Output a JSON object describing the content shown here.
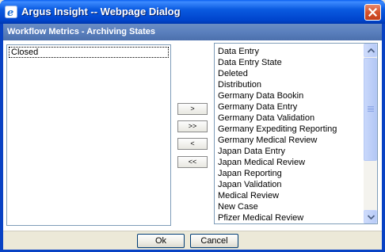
{
  "window": {
    "title": "Argus Insight -- Webpage Dialog",
    "icon": "ie-icon",
    "close_icon": "close-icon"
  },
  "header": {
    "title": "Workflow Metrics - Archiving States"
  },
  "left_list": {
    "items": [
      "Closed"
    ]
  },
  "move_buttons": {
    "add": ">",
    "add_all": ">>",
    "remove": "<",
    "remove_all": "<<"
  },
  "right_list": {
    "items": [
      "Data Entry",
      "Data Entry State",
      "Deleted",
      "Distribution",
      "Germany Data Bookin",
      "Germany Data Entry",
      "Germany Data Validation",
      "Germany Expediting Reporting",
      "Germany Medical Review",
      "Japan Data Entry",
      "Japan Medical Review",
      "Japan Reporting",
      "Japan Validation",
      "Medical Review",
      "New Case",
      "Pfizer Medical Review"
    ]
  },
  "footer": {
    "ok_label": "Ok",
    "cancel_label": "Cancel"
  },
  "colors": {
    "titlebar": "#0a5ae0",
    "header_bar": "#5a7fbd",
    "close_button": "#d5532d",
    "dialog_bg": "#ece9d8"
  }
}
